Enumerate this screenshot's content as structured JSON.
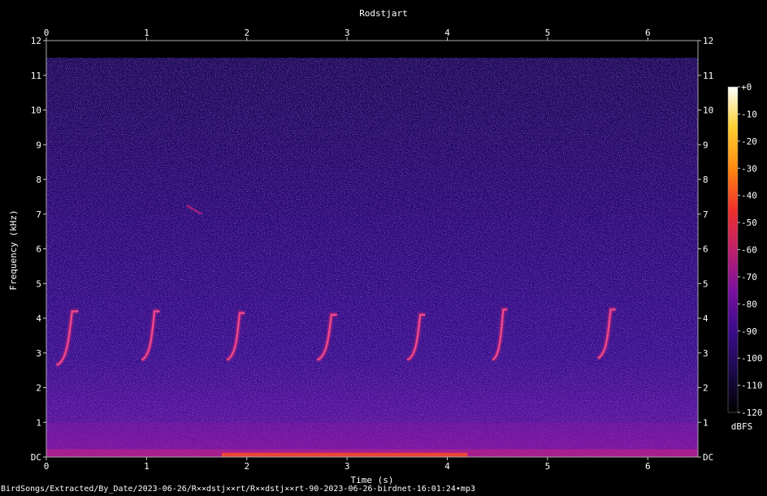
{
  "chart_data": {
    "type": "heatmap",
    "subtype": "spectrogram",
    "title": "Rodstjart",
    "xlabel": "Time (s)",
    "ylabel": "Frequency (kHz)",
    "xlim": [
      0,
      6.5
    ],
    "ylim": [
      0,
      12
    ],
    "x_ticks": [
      "0",
      "1",
      "2",
      "3",
      "4",
      "5",
      "6"
    ],
    "y_ticks": [
      "DC",
      "1",
      "2",
      "3",
      "4",
      "5",
      "6",
      "7",
      "8",
      "9",
      "10",
      "11",
      "12"
    ],
    "colorbar": {
      "label": "dBFS",
      "range": [
        -120,
        0
      ],
      "ticks": [
        "+0",
        "-10",
        "-20",
        "-30",
        "-40",
        "-50",
        "-60",
        "-70",
        "-80",
        "-90",
        "-100",
        "-110",
        "-120"
      ],
      "colormap": [
        "#000000",
        "#1a0a4a",
        "#3a0b8a",
        "#7a10a0",
        "#c0206a",
        "#f0302a",
        "#ff8a10",
        "#ffd030",
        "#ffffff"
      ]
    },
    "noise_ceiling_khz": 11.5,
    "calls": [
      {
        "t_start": 0.1,
        "t_end": 0.32,
        "f_low_khz": 2.65,
        "f_high_khz": 4.2
      },
      {
        "t_start": 0.95,
        "t_end": 1.13,
        "f_low_khz": 2.8,
        "f_high_khz": 4.2
      },
      {
        "t_start": 1.8,
        "t_end": 1.98,
        "f_low_khz": 2.8,
        "f_high_khz": 4.15
      },
      {
        "t_start": 2.7,
        "t_end": 2.9,
        "f_low_khz": 2.8,
        "f_high_khz": 4.1
      },
      {
        "t_start": 3.6,
        "t_end": 3.78,
        "f_low_khz": 2.8,
        "f_high_khz": 4.1
      },
      {
        "t_start": 4.45,
        "t_end": 4.6,
        "f_low_khz": 2.8,
        "f_high_khz": 4.25
      },
      {
        "t_start": 5.5,
        "t_end": 5.68,
        "f_low_khz": 2.85,
        "f_high_khz": 4.25
      }
    ],
    "faint_trace": {
      "t_start": 1.4,
      "t_end": 1.55,
      "f_start_khz": 7.25,
      "f_end_khz": 7.0
    }
  },
  "footer_path": "BirdSongs/Extracted/By_Date/2023-06-26/R××dstj××rt/R××dstj××rt-90-2023-06-26-birdnet-16:01:24•mp3"
}
